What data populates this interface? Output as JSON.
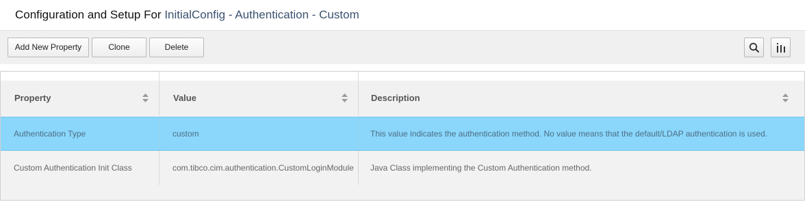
{
  "header": {
    "prefix": "Configuration and Setup For ",
    "breadcrumb": "InitialConfig - Authentication - Custom"
  },
  "toolbar": {
    "add_label": "Add New Property",
    "clone_label": "Clone",
    "delete_label": "Delete",
    "search_icon": "search-icon",
    "columns_icon": "columns-icon"
  },
  "table": {
    "columns": [
      "Property",
      "Value",
      "Description"
    ],
    "rows": [
      {
        "property": "Authentication Type",
        "value": "custom",
        "description": "This value indicates the authentication method. No value means that the default/LDAP authentication is used.",
        "selected": true
      },
      {
        "property": "Custom Authentication Init Class",
        "value": "com.tibco.cim.authentication.CustomLoginModule",
        "description": "Java Class implementing the Custom Authentication method.",
        "selected": false
      }
    ]
  },
  "colors": {
    "selected_row": "#8ad7fb",
    "breadcrumb": "#3a5170"
  }
}
